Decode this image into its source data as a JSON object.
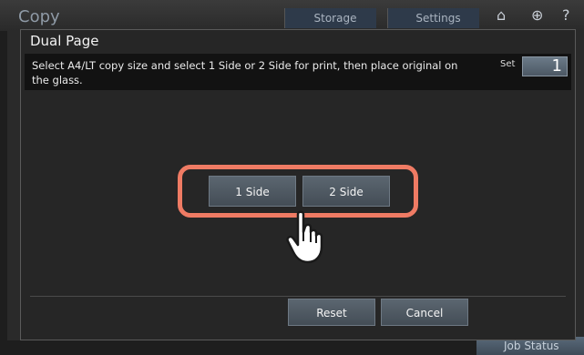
{
  "app": {
    "title": "Copy",
    "storage_label": "Storage",
    "settings_label": "Settings",
    "job_status_label": "Job Status"
  },
  "dialog": {
    "title": "Dual Page",
    "message": "Select A4/LT copy size and select 1 Side or 2 Side for print, then place original on the glass.",
    "set_label": "Set",
    "set_value": "1",
    "one_side_label": "1 Side",
    "two_side_label": "2 Side",
    "reset_label": "Reset",
    "cancel_label": "Cancel"
  },
  "icons": [
    "home-icon",
    "globe-icon",
    "help-icon",
    "hand-pointer-icon"
  ],
  "colors": {
    "highlight": "#ef7b64",
    "accent": "#2e3a4a"
  }
}
